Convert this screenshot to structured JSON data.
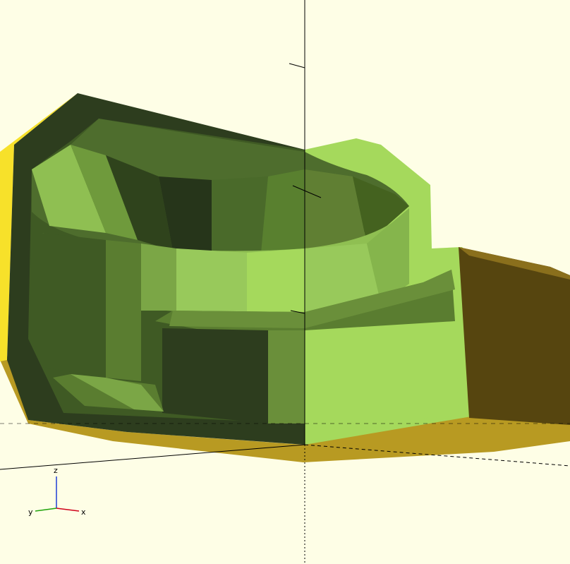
{
  "viewport": {
    "background": "#fefee6",
    "colors": {
      "front_face_light": "#a5d95c",
      "front_face_dark": "#2d3d1e",
      "interior_mid": "#6a8f3a",
      "interior_dark": "#3f5a24",
      "yellow_side": "#f7e12a",
      "gold_bottom": "#b89a22",
      "brown_side": "#56450f",
      "axis_x": "#d0021b",
      "axis_y": "#1fa30b",
      "axis_z": "#1f3fd6"
    },
    "model_name": "render-3d-model",
    "axes_gizmo": {
      "x_label": "x",
      "y_label": "y",
      "z_label": "z"
    }
  }
}
